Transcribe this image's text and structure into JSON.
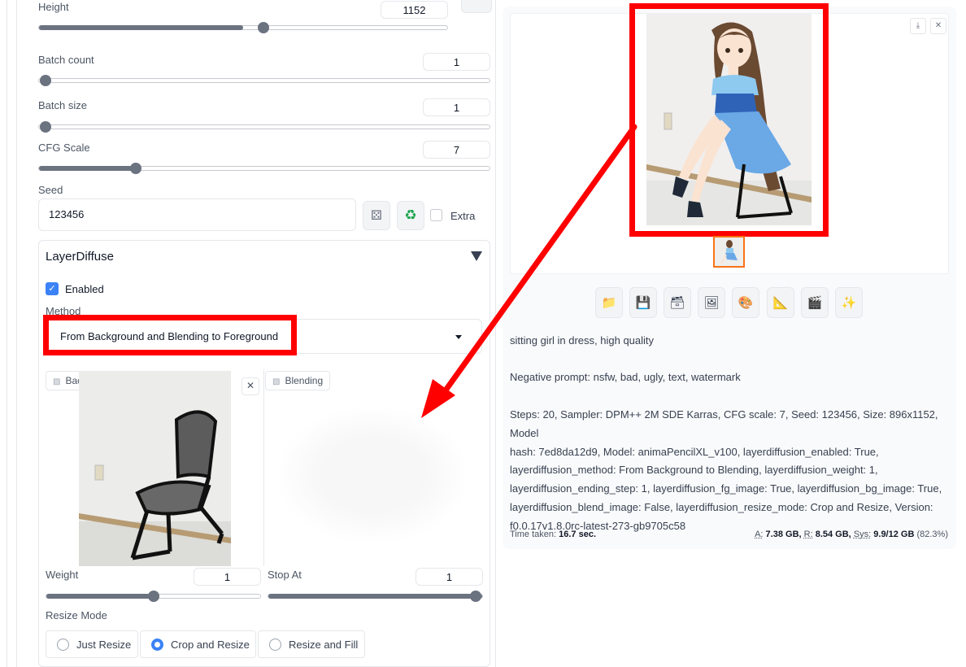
{
  "left": {
    "height": {
      "label": "Height",
      "value": "1152",
      "fraction": 0.5
    },
    "batch_count": {
      "label": "Batch count",
      "value": "1",
      "fraction": 0.0
    },
    "batch_size": {
      "label": "Batch size",
      "value": "1",
      "fraction": 0.0
    },
    "cfg_scale": {
      "label": "CFG Scale",
      "value": "7",
      "fraction": 0.2
    },
    "seed": {
      "label": "Seed",
      "value": "123456",
      "dice_icon": "dice-icon",
      "recycle_icon": "recycle-icon",
      "extra_label": "Extra"
    },
    "layerdiffuse": {
      "title": "LayerDiffuse",
      "enabled_label": "Enabled",
      "method_label": "Method",
      "method_value": "From Background and Blending to Foreground",
      "background_label": "Background",
      "blending_label": "Blending",
      "weight": {
        "label": "Weight",
        "value": "1",
        "fraction": 0.5
      },
      "stop_at": {
        "label": "Stop At",
        "value": "1",
        "fraction": 1.0
      },
      "resize_mode_label": "Resize Mode",
      "resize_options": [
        "Just Resize",
        "Crop and Resize",
        "Resize and Fill"
      ],
      "resize_selected": "Crop and Resize"
    }
  },
  "right": {
    "toolbar_icons": [
      "folder-icon",
      "save-icon",
      "archive-icon",
      "image-icon",
      "palette-icon",
      "ruler-icon",
      "video-icon",
      "sparkle-icon"
    ],
    "prompt": "sitting girl in dress, high quality",
    "negative_prompt": "Negative prompt: nsfw, bad, ugly, text, watermark",
    "params_lines": [
      "Steps: 20, Sampler: DPM++ 2M SDE Karras, CFG scale: 7, Seed: 123456, Size: 896x1152, Model",
      "hash: 7ed8da12d9, Model: animaPencilXL_v100, layerdiffusion_enabled: True,",
      "layerdiffusion_method: From Background to Blending, layerdiffusion_weight: 1,",
      "layerdiffusion_ending_step: 1, layerdiffusion_fg_image: True, layerdiffusion_bg_image: True,",
      "layerdiffusion_blend_image: False, layerdiffusion_resize_mode: Crop and Resize, Version:",
      "f0.0.17v1.8.0rc-latest-273-gb9705c58"
    ],
    "time_taken_label": "Time taken:",
    "time_taken_value": "16.7 sec.",
    "mem_a_label": "A:",
    "mem_a_value": "7.38 GB,",
    "mem_r_label": "R:",
    "mem_r_value": "8.54 GB,",
    "mem_sys_label": "Sys:",
    "mem_sys_value": "9.9/12 GB",
    "mem_pct": "(82.3%)"
  },
  "colors": {
    "accent": "#3b82f6",
    "annotation_red": "#ff0000",
    "thumb_border": "#f97316"
  }
}
